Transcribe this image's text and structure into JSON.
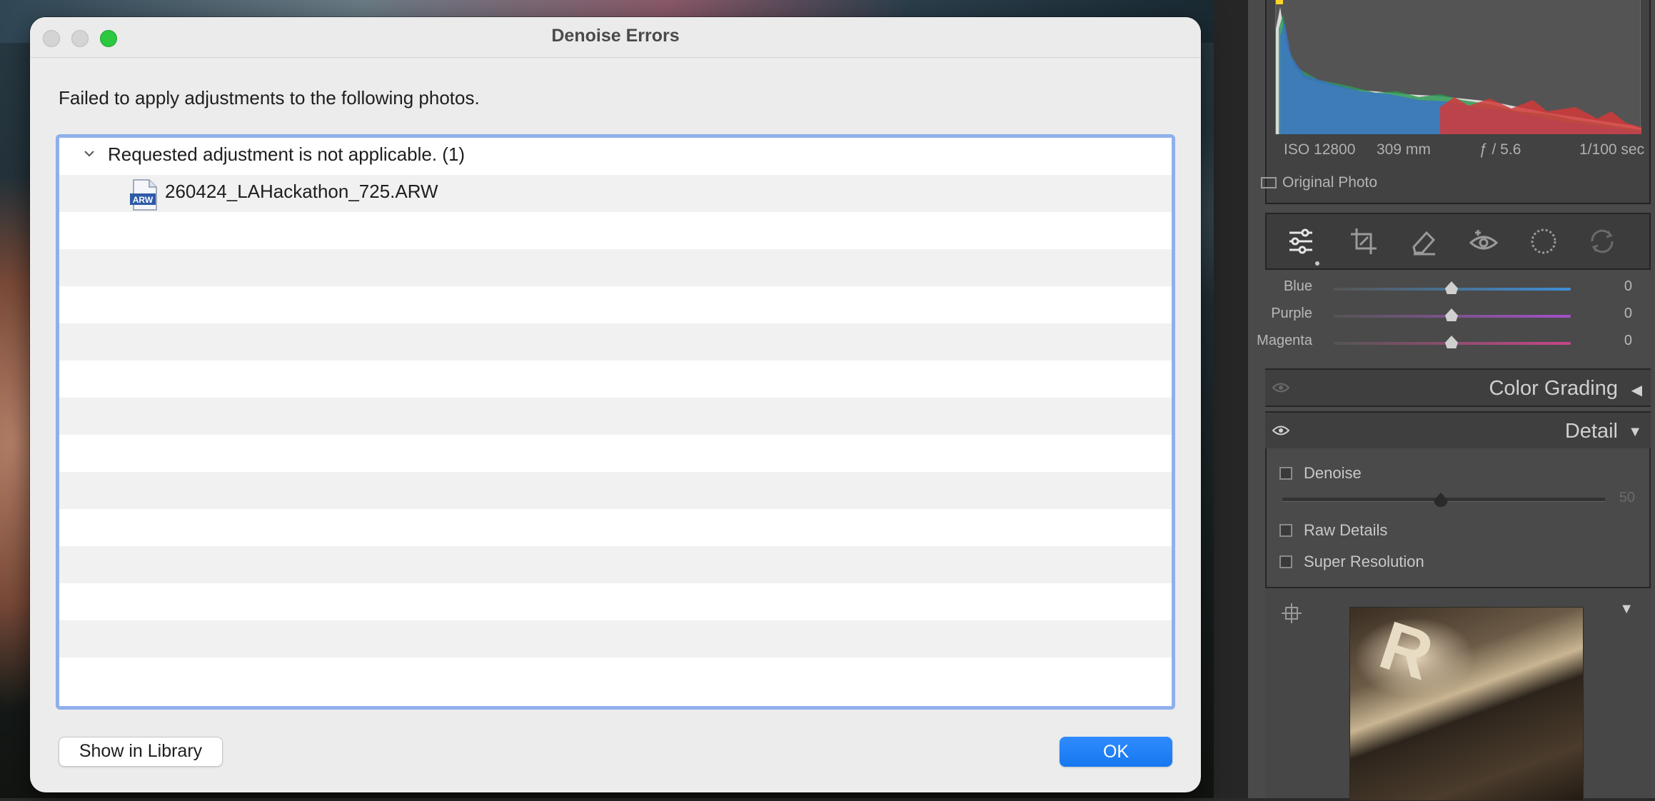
{
  "dialog": {
    "title": "Denoise Errors",
    "message": "Failed to apply adjustments to the following photos.",
    "groups": [
      {
        "label": "Requested adjustment is not applicable. (1)",
        "files": [
          {
            "name": "260424_LAHackathon_725.ARW",
            "icon_text": "ARW"
          }
        ]
      }
    ],
    "buttons": {
      "show_in_library": "Show in Library",
      "ok": "OK"
    }
  },
  "develop_panel": {
    "exif": {
      "iso": "ISO 12800",
      "focal": "309 mm",
      "aperture": "ƒ / 5.6",
      "shutter": "1/100 sec"
    },
    "original_photo_label": "Original Photo",
    "tools": [
      "edit-sliders-icon",
      "crop-icon",
      "healing-eraser-icon",
      "red-eye-icon",
      "masking-icon",
      "presets-icon"
    ],
    "hsl_rows": [
      {
        "label": "Blue",
        "value": "0",
        "color": "#3d8fd6"
      },
      {
        "label": "Purple",
        "value": "0",
        "color": "#a450c8"
      },
      {
        "label": "Magenta",
        "value": "0",
        "color": "#c8458a"
      }
    ],
    "color_grading": {
      "title": "Color Grading",
      "arrow": "◀"
    },
    "detail": {
      "title": "Detail",
      "arrow": "▼",
      "denoise_label": "Denoise",
      "denoise_value": "50",
      "raw_details_label": "Raw Details",
      "super_resolution_label": "Super Resolution"
    },
    "preview_arrow": "▼",
    "preview_letter": "R"
  },
  "colors": {
    "accent_blue": "#1677f0",
    "list_focus_border": "#8fb0ec",
    "zoom_green": "#2bc840"
  }
}
